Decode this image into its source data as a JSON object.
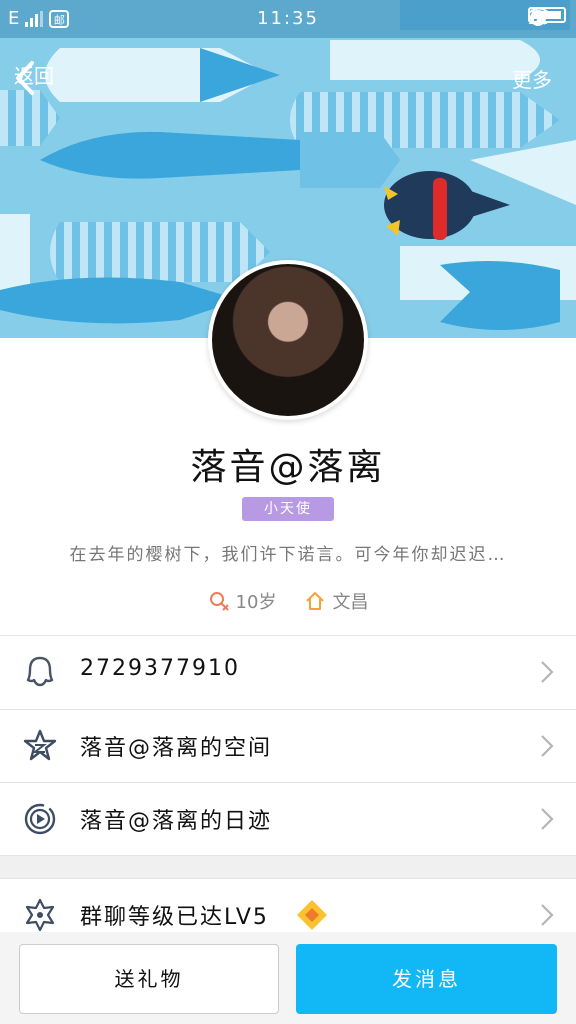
{
  "status_bar": {
    "network": "E",
    "mail_icon_text": "邮",
    "time": "11:35"
  },
  "nav": {
    "back_label": "返回",
    "more_label": "更多"
  },
  "profile": {
    "name": "落音@落离",
    "badge": "小天使",
    "signature": "在去年的樱树下，我们许下诺言。可今年你却迟迟…",
    "age": "10岁",
    "location": "文昌"
  },
  "list": [
    {
      "icon": "qq-penguin-icon",
      "label": "2729377910"
    },
    {
      "icon": "qzone-star-icon",
      "label": "落音@落离的空间"
    },
    {
      "icon": "daily-trail-icon",
      "label": "落音@落离的日迹"
    },
    {
      "icon": "group-level-icon",
      "label": "群聊等级已达LV5"
    }
  ],
  "actions": {
    "gift_label": "送礼物",
    "message_label": "发消息"
  },
  "colors": {
    "accent": "#12b7f5",
    "badge": "#b79ae3",
    "banner": "#86cdea"
  }
}
